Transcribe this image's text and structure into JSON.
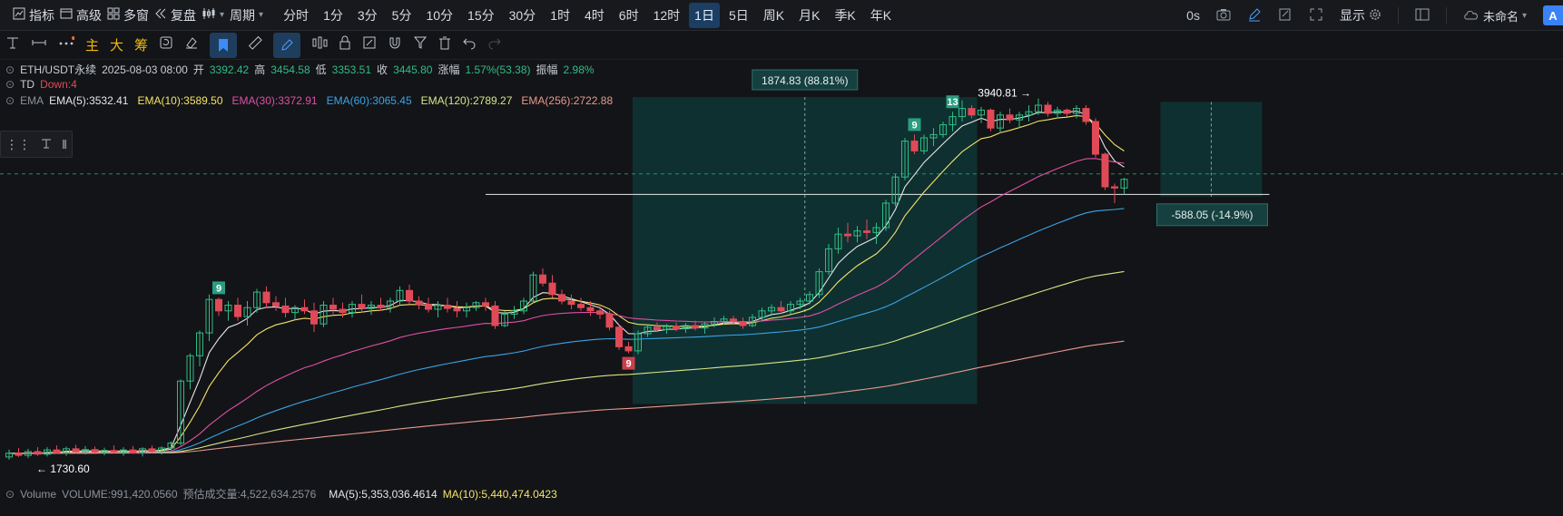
{
  "toolbar": {
    "indicators": "指标",
    "advanced": "高级",
    "multi_window": "多窗",
    "replay": "复盘",
    "period_label": "周期",
    "periods": [
      "分时",
      "1分",
      "3分",
      "5分",
      "10分",
      "15分",
      "30分",
      "1时",
      "4时",
      "6时",
      "12时",
      "1日",
      "5日",
      "周K",
      "月K",
      "季K",
      "年K"
    ],
    "active_period": "1日",
    "countdown": "0s",
    "display": "显示",
    "workspace": "未命名",
    "avatar": "A"
  },
  "drawing_toolbar": {
    "main": "主",
    "big": "大",
    "chips": "筹"
  },
  "header": {
    "symbol": "ETH/USDT永续",
    "datetime": "2025-08-03 08:00",
    "open_label": "开",
    "open": "3392.42",
    "high_label": "高",
    "high": "3454.58",
    "low_label": "低",
    "low": "3353.51",
    "close_label": "收",
    "close": "3445.80",
    "change_label": "涨幅",
    "change": "1.57%(53.38)",
    "amplitude_label": "振幅",
    "amplitude": "2.98%"
  },
  "td": {
    "label": "TD",
    "value": "Down:4"
  },
  "ema": {
    "label": "EMA",
    "items": [
      {
        "text": "EMA(5):3532.41",
        "color": "#e6e6e6"
      },
      {
        "text": "EMA(10):3589.50",
        "color": "#f3e36a"
      },
      {
        "text": "EMA(30):3372.91",
        "color": "#e04fa6"
      },
      {
        "text": "EMA(60):3065.45",
        "color": "#39a4e8"
      },
      {
        "text": "EMA(120):2789.27",
        "color": "#d8e487"
      },
      {
        "text": "EMA(256):2722.88",
        "color": "#e79a8e"
      }
    ]
  },
  "volume": {
    "label": "Volume",
    "value": "VOLUME:991,420.0560",
    "estimate": "预估成交量:4,522,634.2576",
    "ma5": "MA(5):5,353,036.4614",
    "ma10": "MA(10):5,440,474.0423"
  },
  "chart_data": {
    "type": "candlestick",
    "symbol": "ETH/USDT永续",
    "interval": "1日",
    "candles": [
      {
        "o": 1745,
        "h": 1790,
        "l": 1728,
        "c": 1768
      },
      {
        "o": 1768,
        "h": 1800,
        "l": 1745,
        "c": 1755
      },
      {
        "o": 1755,
        "h": 1795,
        "l": 1738,
        "c": 1778
      },
      {
        "o": 1778,
        "h": 1805,
        "l": 1752,
        "c": 1762
      },
      {
        "o": 1762,
        "h": 1805,
        "l": 1748,
        "c": 1788
      },
      {
        "o": 1788,
        "h": 1815,
        "l": 1765,
        "c": 1770
      },
      {
        "o": 1770,
        "h": 1808,
        "l": 1752,
        "c": 1795
      },
      {
        "o": 1795,
        "h": 1820,
        "l": 1770,
        "c": 1778
      },
      {
        "o": 1778,
        "h": 1812,
        "l": 1760,
        "c": 1790
      },
      {
        "o": 1790,
        "h": 1808,
        "l": 1762,
        "c": 1775
      },
      {
        "o": 1775,
        "h": 1802,
        "l": 1755,
        "c": 1785
      },
      {
        "o": 1785,
        "h": 1815,
        "l": 1765,
        "c": 1775
      },
      {
        "o": 1775,
        "h": 1805,
        "l": 1752,
        "c": 1788
      },
      {
        "o": 1788,
        "h": 1812,
        "l": 1765,
        "c": 1770
      },
      {
        "o": 1770,
        "h": 1805,
        "l": 1748,
        "c": 1795
      },
      {
        "o": 1795,
        "h": 1815,
        "l": 1770,
        "c": 1778
      },
      {
        "o": 1778,
        "h": 1810,
        "l": 1760,
        "c": 1800
      },
      {
        "o": 1800,
        "h": 1840,
        "l": 1785,
        "c": 1830
      },
      {
        "o": 1830,
        "h": 2220,
        "l": 1815,
        "c": 2210
      },
      {
        "o": 2210,
        "h": 2380,
        "l": 2160,
        "c": 2365
      },
      {
        "o": 2365,
        "h": 2520,
        "l": 2300,
        "c": 2505
      },
      {
        "o": 2505,
        "h": 2740,
        "l": 2455,
        "c": 2710
      },
      {
        "o": 2710,
        "h": 2720,
        "l": 2610,
        "c": 2640
      },
      {
        "o": 2640,
        "h": 2700,
        "l": 2580,
        "c": 2675
      },
      {
        "o": 2675,
        "h": 2720,
        "l": 2580,
        "c": 2605
      },
      {
        "o": 2605,
        "h": 2700,
        "l": 2550,
        "c": 2660
      },
      {
        "o": 2660,
        "h": 2775,
        "l": 2630,
        "c": 2755
      },
      {
        "o": 2755,
        "h": 2790,
        "l": 2655,
        "c": 2690
      },
      {
        "o": 2690,
        "h": 2730,
        "l": 2640,
        "c": 2670
      },
      {
        "o": 2670,
        "h": 2720,
        "l": 2600,
        "c": 2630
      },
      {
        "o": 2630,
        "h": 2675,
        "l": 2585,
        "c": 2660
      },
      {
        "o": 2660,
        "h": 2710,
        "l": 2620,
        "c": 2640
      },
      {
        "o": 2640,
        "h": 2690,
        "l": 2510,
        "c": 2560
      },
      {
        "o": 2560,
        "h": 2700,
        "l": 2540,
        "c": 2675
      },
      {
        "o": 2675,
        "h": 2720,
        "l": 2620,
        "c": 2650
      },
      {
        "o": 2650,
        "h": 2690,
        "l": 2600,
        "c": 2630
      },
      {
        "o": 2630,
        "h": 2700,
        "l": 2600,
        "c": 2680
      },
      {
        "o": 2680,
        "h": 2740,
        "l": 2630,
        "c": 2655
      },
      {
        "o": 2655,
        "h": 2700,
        "l": 2615,
        "c": 2675
      },
      {
        "o": 2675,
        "h": 2720,
        "l": 2640,
        "c": 2660
      },
      {
        "o": 2660,
        "h": 2720,
        "l": 2630,
        "c": 2700
      },
      {
        "o": 2700,
        "h": 2790,
        "l": 2670,
        "c": 2765
      },
      {
        "o": 2765,
        "h": 2800,
        "l": 2680,
        "c": 2700
      },
      {
        "o": 2700,
        "h": 2730,
        "l": 2650,
        "c": 2680
      },
      {
        "o": 2680,
        "h": 2720,
        "l": 2630,
        "c": 2650
      },
      {
        "o": 2650,
        "h": 2700,
        "l": 2600,
        "c": 2675
      },
      {
        "o": 2675,
        "h": 2720,
        "l": 2630,
        "c": 2655
      },
      {
        "o": 2655,
        "h": 2700,
        "l": 2600,
        "c": 2640
      },
      {
        "o": 2640,
        "h": 2690,
        "l": 2600,
        "c": 2660
      },
      {
        "o": 2660,
        "h": 2700,
        "l": 2640,
        "c": 2690
      },
      {
        "o": 2690,
        "h": 2720,
        "l": 2640,
        "c": 2670
      },
      {
        "o": 2670,
        "h": 2700,
        "l": 2530,
        "c": 2550
      },
      {
        "o": 2550,
        "h": 2640,
        "l": 2540,
        "c": 2620
      },
      {
        "o": 2620,
        "h": 2670,
        "l": 2590,
        "c": 2640
      },
      {
        "o": 2640,
        "h": 2720,
        "l": 2620,
        "c": 2700
      },
      {
        "o": 2700,
        "h": 2880,
        "l": 2690,
        "c": 2860
      },
      {
        "o": 2860,
        "h": 2900,
        "l": 2790,
        "c": 2810
      },
      {
        "o": 2810,
        "h": 2860,
        "l": 2720,
        "c": 2740
      },
      {
        "o": 2740,
        "h": 2770,
        "l": 2680,
        "c": 2700
      },
      {
        "o": 2700,
        "h": 2740,
        "l": 2650,
        "c": 2680
      },
      {
        "o": 2680,
        "h": 2720,
        "l": 2640,
        "c": 2660
      },
      {
        "o": 2660,
        "h": 2700,
        "l": 2610,
        "c": 2640
      },
      {
        "o": 2640,
        "h": 2680,
        "l": 2590,
        "c": 2620
      },
      {
        "o": 2620,
        "h": 2640,
        "l": 2520,
        "c": 2540
      },
      {
        "o": 2540,
        "h": 2560,
        "l": 2400,
        "c": 2420
      },
      {
        "o": 2420,
        "h": 2450,
        "l": 2380,
        "c": 2395
      },
      {
        "o": 2395,
        "h": 2520,
        "l": 2375,
        "c": 2500
      },
      {
        "o": 2500,
        "h": 2560,
        "l": 2480,
        "c": 2540
      },
      {
        "o": 2540,
        "h": 2570,
        "l": 2510,
        "c": 2525
      },
      {
        "o": 2525,
        "h": 2560,
        "l": 2500,
        "c": 2545
      },
      {
        "o": 2545,
        "h": 2570,
        "l": 2515,
        "c": 2530
      },
      {
        "o": 2530,
        "h": 2565,
        "l": 2505,
        "c": 2550
      },
      {
        "o": 2550,
        "h": 2580,
        "l": 2520,
        "c": 2535
      },
      {
        "o": 2535,
        "h": 2570,
        "l": 2500,
        "c": 2560
      },
      {
        "o": 2560,
        "h": 2600,
        "l": 2540,
        "c": 2575
      },
      {
        "o": 2575,
        "h": 2610,
        "l": 2555,
        "c": 2590
      },
      {
        "o": 2590,
        "h": 2610,
        "l": 2560,
        "c": 2575
      },
      {
        "o": 2575,
        "h": 2600,
        "l": 2530,
        "c": 2550
      },
      {
        "o": 2550,
        "h": 2620,
        "l": 2540,
        "c": 2600
      },
      {
        "o": 2600,
        "h": 2660,
        "l": 2580,
        "c": 2640
      },
      {
        "o": 2640,
        "h": 2680,
        "l": 2610,
        "c": 2660
      },
      {
        "o": 2660,
        "h": 2700,
        "l": 2620,
        "c": 2640
      },
      {
        "o": 2640,
        "h": 2700,
        "l": 2620,
        "c": 2680
      },
      {
        "o": 2680,
        "h": 2720,
        "l": 2650,
        "c": 2700
      },
      {
        "o": 2700,
        "h": 2760,
        "l": 2680,
        "c": 2740
      },
      {
        "o": 2740,
        "h": 2900,
        "l": 2720,
        "c": 2880
      },
      {
        "o": 2880,
        "h": 3050,
        "l": 2860,
        "c": 3020
      },
      {
        "o": 3020,
        "h": 3150,
        "l": 2990,
        "c": 3110
      },
      {
        "o": 3110,
        "h": 3180,
        "l": 3060,
        "c": 3100
      },
      {
        "o": 3100,
        "h": 3160,
        "l": 3060,
        "c": 3130
      },
      {
        "o": 3130,
        "h": 3200,
        "l": 3080,
        "c": 3120
      },
      {
        "o": 3120,
        "h": 3180,
        "l": 3050,
        "c": 3150
      },
      {
        "o": 3150,
        "h": 3320,
        "l": 3130,
        "c": 3300
      },
      {
        "o": 3300,
        "h": 3480,
        "l": 3280,
        "c": 3460
      },
      {
        "o": 3460,
        "h": 3700,
        "l": 3440,
        "c": 3680
      },
      {
        "o": 3680,
        "h": 3720,
        "l": 3600,
        "c": 3620
      },
      {
        "o": 3620,
        "h": 3720,
        "l": 3600,
        "c": 3700
      },
      {
        "o": 3700,
        "h": 3760,
        "l": 3650,
        "c": 3720
      },
      {
        "o": 3720,
        "h": 3800,
        "l": 3700,
        "c": 3780
      },
      {
        "o": 3780,
        "h": 3860,
        "l": 3740,
        "c": 3830
      },
      {
        "o": 3830,
        "h": 3930,
        "l": 3800,
        "c": 3880
      },
      {
        "o": 3880,
        "h": 3900,
        "l": 3820,
        "c": 3840
      },
      {
        "o": 3840,
        "h": 3890,
        "l": 3790,
        "c": 3870
      },
      {
        "o": 3870,
        "h": 3880,
        "l": 3740,
        "c": 3760
      },
      {
        "o": 3760,
        "h": 3860,
        "l": 3730,
        "c": 3840
      },
      {
        "o": 3840,
        "h": 3880,
        "l": 3790,
        "c": 3810
      },
      {
        "o": 3810,
        "h": 3860,
        "l": 3760,
        "c": 3840
      },
      {
        "o": 3840,
        "h": 3900,
        "l": 3800,
        "c": 3860
      },
      {
        "o": 3860,
        "h": 3940.81,
        "l": 3840,
        "c": 3900
      },
      {
        "o": 3900,
        "h": 3920,
        "l": 3830,
        "c": 3850
      },
      {
        "o": 3850,
        "h": 3890,
        "l": 3820,
        "c": 3870
      },
      {
        "o": 3870,
        "h": 3880,
        "l": 3830,
        "c": 3850
      },
      {
        "o": 3850,
        "h": 3900,
        "l": 3820,
        "c": 3880
      },
      {
        "o": 3880,
        "h": 3900,
        "l": 3780,
        "c": 3800
      },
      {
        "o": 3800,
        "h": 3820,
        "l": 3580,
        "c": 3600
      },
      {
        "o": 3600,
        "h": 3610,
        "l": 3380,
        "c": 3400
      },
      {
        "o": 3400,
        "h": 3420,
        "l": 3300,
        "c": 3392.42
      },
      {
        "o": 3392.42,
        "h": 3454.58,
        "l": 3353.51,
        "c": 3445.8
      }
    ],
    "price_labels": {
      "high_marker": "3940.81",
      "low_marker": "1730.60"
    },
    "td_markers": [
      {
        "index": 22,
        "text": "9",
        "side": "up"
      },
      {
        "index": 65,
        "text": "9",
        "side": "down"
      },
      {
        "index": 95,
        "text": "9",
        "side": "up"
      },
      {
        "index": 99,
        "text": "13",
        "side": "up"
      }
    ],
    "annotations": {
      "range_up": "1874.83 (88.81%)",
      "range_down": "-588.05 (-14.9%)",
      "horizontal_line_price": 3353.51
    },
    "colors": {
      "up": "#2ebd85",
      "down": "#e04a58",
      "range_fill": "#0f3a3a",
      "ema5": "#e6e6e6",
      "ema10": "#f3e36a",
      "ema30": "#e04fa6",
      "ema60": "#39a4e8",
      "ema120": "#d8e487",
      "ema256": "#e79a8e"
    }
  }
}
